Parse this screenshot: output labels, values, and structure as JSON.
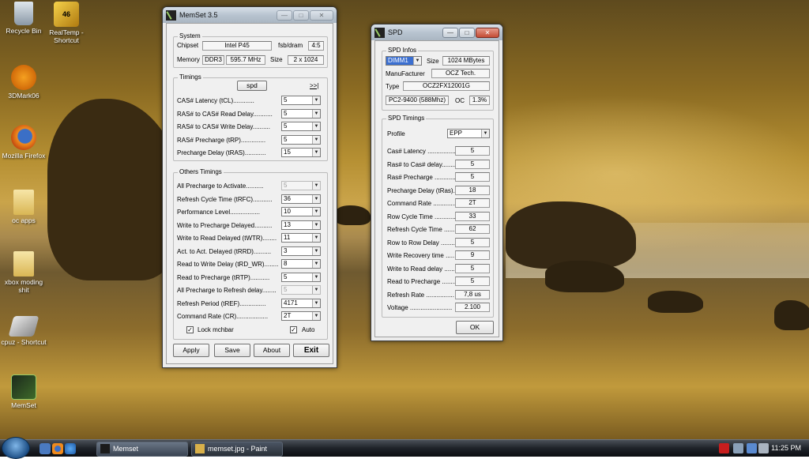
{
  "desktop_icons": [
    {
      "label": "Recycle Bin",
      "icon": "recycle-bin-icon"
    },
    {
      "label": "RealTemp - Shortcut",
      "icon": "realtemp-icon"
    },
    {
      "label": "3DMark06",
      "icon": "3dmark-icon"
    },
    {
      "label": "Mozilla Firefox",
      "icon": "firefox-icon"
    },
    {
      "label": "oc apps",
      "icon": "folder-icon"
    },
    {
      "label": "xbox moding shit",
      "icon": "folder-icon"
    },
    {
      "label": "cpuz - Shortcut",
      "icon": "cpuz-icon"
    },
    {
      "label": "MemSet",
      "icon": "memset-icon"
    }
  ],
  "realtemp_badge": "46",
  "memset": {
    "title": "MemSet 3.5",
    "system": {
      "title": "System",
      "chipset_label": "Chipset",
      "chipset": "Intel P45",
      "fsb_label": "fsb/dram",
      "fsb": "4:5",
      "memory_label": "Memory",
      "mem_type": "DDR3",
      "mem_freq": "595.7 MHz",
      "size_label": "Size",
      "size": "2 x 1024"
    },
    "timings": {
      "title": "Timings",
      "spd_button": "spd",
      "next_button": ">>|",
      "rows": [
        {
          "label": "CAS# Latency (tCL)............",
          "value": "5"
        },
        {
          "label": "RAS# to CAS# Read Delay...........",
          "value": "5"
        },
        {
          "label": "RAS# to CAS# Write Delay..........",
          "value": "5"
        },
        {
          "label": "RAS# Precharge (tRP)..............",
          "value": "5"
        },
        {
          "label": "Precharge Delay  (tRAS)............",
          "value": "15"
        }
      ]
    },
    "others": {
      "title": "Others Timings",
      "rows": [
        {
          "label": "All Precharge to Activate..........",
          "value": "5",
          "disabled": true
        },
        {
          "label": "Refresh Cycle Time (tRFC)...........",
          "value": "36"
        },
        {
          "label": "Performance Level.................",
          "value": "10"
        },
        {
          "label": "Write to Precharge Delayed..........",
          "value": "13"
        },
        {
          "label": "Write to Read Delayed (tWTR)........",
          "value": "11"
        },
        {
          "label": "Act. to Act. Delayed (tRRD)..........",
          "value": "3"
        },
        {
          "label": "Read to Write Delay (tRD_WR)........",
          "value": "8"
        },
        {
          "label": "Read to Precharge (tRTP)...........",
          "value": "5"
        },
        {
          "label": "All Precharge to Refresh delay........",
          "value": "5",
          "disabled": true
        },
        {
          "label": "Refresh Period (tREF)...............",
          "value": "4171"
        },
        {
          "label": "Command Rate (CR)..................",
          "value": "2T"
        }
      ],
      "lock_label": "Lock mchbar",
      "auto_label": "Auto",
      "check_mark": "✓"
    },
    "buttons": {
      "apply": "Apply",
      "save": "Save",
      "about": "About",
      "exit": "Exit"
    }
  },
  "spd": {
    "title": "SPD",
    "infos": {
      "title": "SPD Infos",
      "dimm": "DIMM1",
      "size_label": "Size",
      "size": "1024 MBytes",
      "manufacturer_label": "ManuFacturer",
      "manufacturer": "OCZ Tech.",
      "type_label": "Type",
      "type": "OCZ2FX12001G",
      "speed": "PC2-9400 (588Mhz)",
      "oc_label": "OC",
      "oc": "1.3%"
    },
    "timings": {
      "title": "SPD Timings",
      "profile_label": "Profile",
      "profile": "EPP",
      "rows": [
        {
          "label": "Cas# Latency ...................",
          "value": "5"
        },
        {
          "label": "Ras# to Cas# delay.........",
          "value": "5"
        },
        {
          "label": "Ras# Precharge ...............",
          "value": "5"
        },
        {
          "label": "Precharge Delay (tRas).",
          "value": "18"
        },
        {
          "label": "Command Rate ...............",
          "value": "2T"
        },
        {
          "label": "Row Cycle Time ..............",
          "value": "33"
        },
        {
          "label": "Refresh Cycle Time .........",
          "value": "62"
        },
        {
          "label": "Row to Row Delay ..........",
          "value": "5"
        },
        {
          "label": "Write Recovery time ......",
          "value": "9"
        },
        {
          "label": "Write to Read delay .......",
          "value": "5"
        },
        {
          "label": "Read to Precharge .........",
          "value": "5"
        },
        {
          "label": "Refresh Rate ................",
          "value": "7,8 us"
        },
        {
          "label": "Voltage ........................",
          "value": "2.100"
        }
      ]
    },
    "ok_button": "OK"
  },
  "window_controls": {
    "minimize": "—",
    "maximize": "□",
    "close": "✕"
  },
  "taskbar": {
    "tasks": [
      {
        "label": "Memset",
        "active": true
      },
      {
        "label": "memset.jpg - Paint",
        "active": false
      }
    ],
    "clock": "11:25 PM"
  }
}
